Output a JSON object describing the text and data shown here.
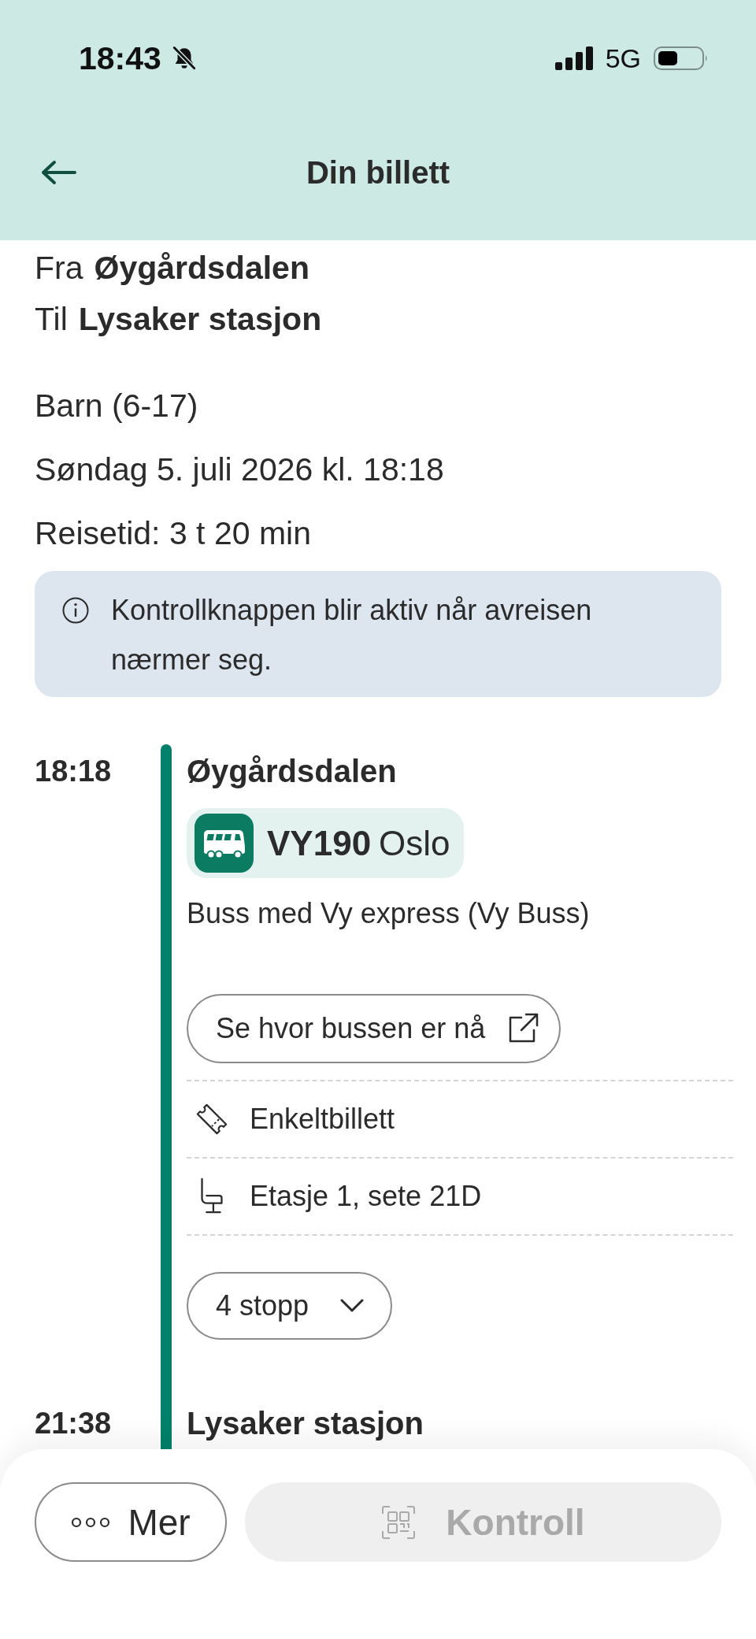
{
  "status_bar": {
    "time": "18:43",
    "silent": true,
    "network": "5G"
  },
  "header": {
    "title": "Din billett"
  },
  "trip": {
    "from_label": "Fra",
    "from": "Øygårdsdalen",
    "to_label": "Til",
    "to": "Lysaker stasjon"
  },
  "details": [
    "Barn (6-17)",
    "Søndag 5. juli 2026 kl. 18:18",
    "Reisetid: 3 t 20 min"
  ],
  "notice": {
    "text": "Kontrollknappen blir aktiv når avreisen nærmer seg."
  },
  "timeline": {
    "departure": {
      "time": "18:18",
      "stop": "Øygårdsdalen"
    },
    "leg": {
      "line": {
        "code": "VY190",
        "destination": "Oslo"
      },
      "description": "Buss med Vy express (Vy Buss)",
      "live_button": "Se hvor bussen er nå",
      "info_rows": [
        {
          "kind": "ticket",
          "text": "Enkeltbillett"
        },
        {
          "kind": "seat",
          "text": "Etasje 1, sete 21D"
        }
      ],
      "stops_button": {
        "label": "4 stopp",
        "expanded": false
      }
    },
    "arrival": {
      "time": "21:38",
      "stop": "Lysaker stasjon"
    }
  },
  "actions": [
    {
      "kind": "more",
      "label": "Mer",
      "disabled": false
    },
    {
      "kind": "control",
      "label": "Kontroll",
      "disabled": true
    }
  ]
}
